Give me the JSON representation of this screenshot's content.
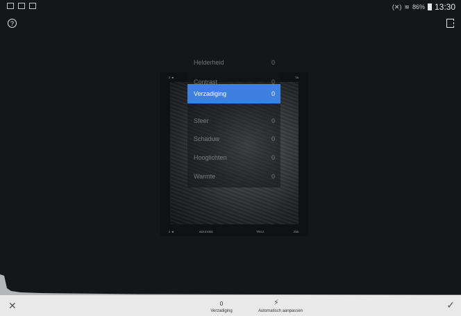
{
  "status_bar": {
    "left_icons": [
      "image-icon",
      "mail-icon",
      "mail-icon"
    ],
    "signal": "(✕)",
    "battery_percent": "86%",
    "time": "13:30"
  },
  "top_icons": {
    "help": "?",
    "compare": "compare-icon"
  },
  "photo": {
    "film_top_left": "2 ◄",
    "film_top_right": "7А",
    "film_bottom_left": "2 ◄",
    "film_bottom_mid1": "AD13  0301",
    "film_bottom_mid2": "TRX 2",
    "film_bottom_right": "23А"
  },
  "menu": {
    "items": [
      {
        "label": "Helderheid",
        "value": "0"
      },
      {
        "label": "Contrast",
        "value": "0"
      },
      {
        "label": "Verzadiging",
        "value": "0"
      },
      {
        "label": "Sfeer",
        "value": "0"
      },
      {
        "label": "Schaduw",
        "value": "0"
      },
      {
        "label": "Hooglichten",
        "value": "0"
      },
      {
        "label": "Warmte",
        "value": "0"
      }
    ],
    "selected_index": 2
  },
  "bottom_bar": {
    "close": "✕",
    "current_value": "0",
    "current_label": "Verzadiging",
    "auto_adjust_label": "Automatisch aanpassen",
    "confirm": "✓"
  },
  "colors": {
    "accent": "#3f7fe0",
    "background": "#14171a",
    "bottom_bar": "#e9e9e9"
  }
}
